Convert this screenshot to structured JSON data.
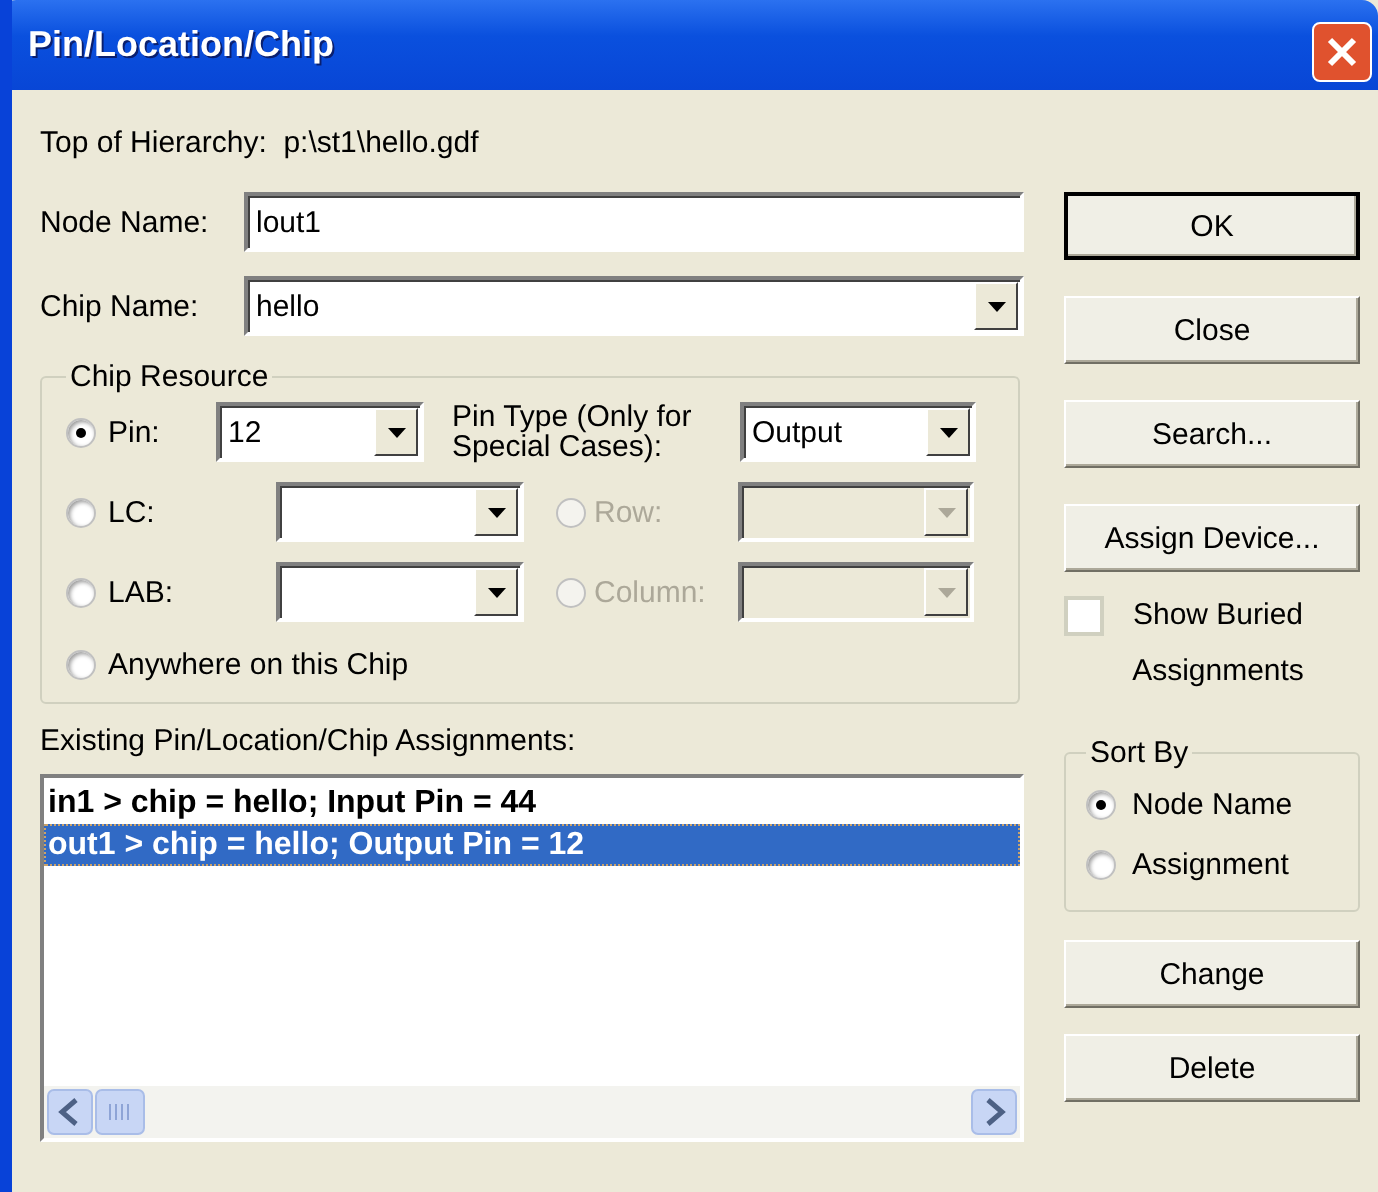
{
  "window": {
    "title": "Pin/Location/Chip"
  },
  "hierarchy": {
    "label": "Top of Hierarchy:",
    "value": "p:\\st1\\hello.gdf"
  },
  "node_name": {
    "label": "Node Name:",
    "value": "lout1"
  },
  "chip_name": {
    "label": "Chip Name:",
    "value": "hello"
  },
  "chip_resource": {
    "title": "Chip Resource",
    "options": [
      {
        "kind": "combo",
        "label": "Pin:",
        "selected": true,
        "value": "12"
      },
      {
        "kind": "combo",
        "label": "LC:",
        "selected": false
      },
      {
        "kind": "combo",
        "label": "LAB:",
        "selected": false
      },
      {
        "kind": "plain",
        "label": "Anywhere on this Chip",
        "selected": false
      }
    ],
    "side": [
      {
        "kind": "label",
        "label": "Pin Type (Only for Special Cases):",
        "value": "Output",
        "disabled": false
      },
      {
        "kind": "radio",
        "label": "Row:",
        "selected": false,
        "disabled": true
      },
      {
        "kind": "radio",
        "label": "Column:",
        "selected": false,
        "disabled": true
      }
    ]
  },
  "assignments": {
    "label": "Existing Pin/Location/Chip Assignments:",
    "rows": [
      {
        "text": "in1 > chip = hello; Input Pin = 44",
        "selected": false
      },
      {
        "text": "out1 > chip = hello; Output Pin = 12",
        "selected": true
      }
    ]
  },
  "buttons": [
    {
      "label": "OK",
      "default": true
    },
    {
      "label": "Close",
      "default": false
    },
    {
      "label": "Search...",
      "default": false
    },
    {
      "label": "Assign Device...",
      "default": false
    }
  ],
  "show_buried": {
    "label": "Show Buried Assignments",
    "checked": false
  },
  "sort_by": {
    "title": "Sort By",
    "options": [
      {
        "label": "Node Name",
        "selected": true
      },
      {
        "label": "Assignment",
        "selected": false
      }
    ]
  },
  "bottom_buttons": [
    "Change",
    "Delete"
  ]
}
